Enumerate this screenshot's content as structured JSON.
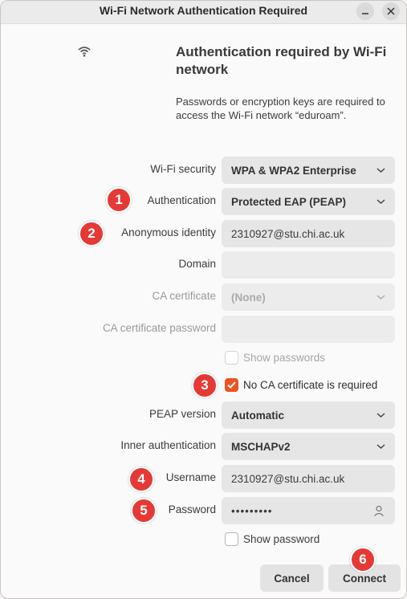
{
  "window": {
    "title": "Wi-Fi Network Authentication Required"
  },
  "header": {
    "icon": "wifi-icon",
    "heading": "Authentication required by Wi-Fi network",
    "description": "Passwords or encryption keys are required to access the Wi-Fi network “eduroam”."
  },
  "form": {
    "wifi_security": {
      "label": "Wi-Fi security",
      "value": "WPA & WPA2 Enterprise"
    },
    "authentication": {
      "label": "Authentication",
      "value": "Protected EAP (PEAP)"
    },
    "anonymous_identity": {
      "label": "Anonymous identity",
      "value": "2310927@stu.chi.ac.uk"
    },
    "domain": {
      "label": "Domain",
      "value": ""
    },
    "ca_certificate": {
      "label": "CA certificate",
      "value": "(None)"
    },
    "ca_certificate_password": {
      "label": "CA certificate password",
      "value": ""
    },
    "show_passwords": {
      "label": "Show passwords",
      "checked": false
    },
    "no_ca_required": {
      "label": "No CA certificate is required",
      "checked": true
    },
    "peap_version": {
      "label": "PEAP version",
      "value": "Automatic"
    },
    "inner_auth": {
      "label": "Inner authentication",
      "value": "MSCHAPv2"
    },
    "username": {
      "label": "Username",
      "value": "2310927@stu.chi.ac.uk"
    },
    "password": {
      "label": "Password",
      "value": "•••••••••"
    },
    "show_password": {
      "label": "Show password",
      "checked": false
    }
  },
  "buttons": {
    "cancel": "Cancel",
    "connect": "Connect"
  },
  "annotations": [
    "1",
    "2",
    "3",
    "4",
    "5",
    "6"
  ],
  "colors": {
    "accent": "#e95420",
    "badge": "#e53935"
  }
}
